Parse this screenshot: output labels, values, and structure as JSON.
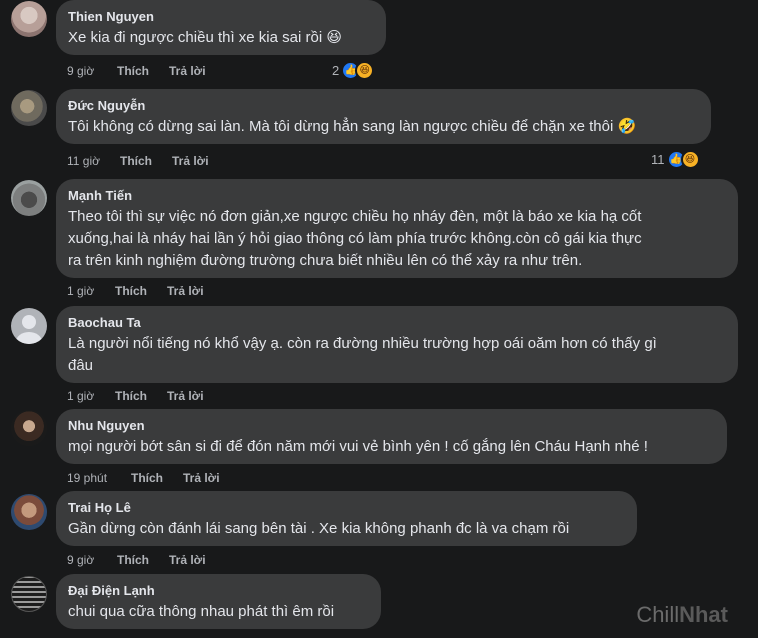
{
  "comments": [
    {
      "author": "Thien Nguyen",
      "text": "Xe kia đi ngược chiều thì xe kia sai rồi 😆",
      "time": "9 giờ",
      "like": "Thích",
      "reply": "Trả lời",
      "reaction_count": "2",
      "reactions": [
        "like",
        "haha"
      ]
    },
    {
      "author": "Đức Nguyễn",
      "text": "Tôi không có dừng sai làn. Mà tôi dừng hẳn sang làn ngược chiều để chặn xe thôi 🤣",
      "time": "11 giờ",
      "like": "Thích",
      "reply": "Trả lời",
      "reaction_count": "11",
      "reactions": [
        "like",
        "haha"
      ]
    },
    {
      "author": "Mạnh Tiến",
      "text_lines": [
        "Theo tôi thì sự việc nó đơn giản,xe ngược chiều họ nháy đèn, một là báo xe kia hạ cốt",
        "xuống,hai là nháy hai lần ý hỏi giao thông có làm phía trước không.còn cô gái kia thực",
        "ra trên kinh nghiệm đường trường chưa biết nhiều lên có thể xảy ra như trên."
      ],
      "time": "1 giờ",
      "like": "Thích",
      "reply": "Trả lời"
    },
    {
      "author": "Baochau Ta",
      "text_lines": [
        "Là người nổi tiếng nó khổ vậy ạ. còn ra đường nhiều trường hợp oái oăm hơn có thấy gì",
        "đâu"
      ],
      "time": "1 giờ",
      "like": "Thích",
      "reply": "Trả lời"
    },
    {
      "author": "Nhu Nguyen",
      "text": "mọi người bớt sân si đi để đón năm mới vui vẻ bình yên ! cố gắng lên Cháu Hạnh nhé !",
      "time": "19 phút",
      "like": "Thích",
      "reply": "Trả lời"
    },
    {
      "author": "Trai Họ Lê",
      "text": "Gần dừng còn đánh lái sang bên tài . Xe kia không phanh đc là va chạm rồi",
      "time": "9 giờ",
      "like": "Thích",
      "reply": "Trả lời"
    },
    {
      "author": "Đại Điện Lạnh",
      "text": "chui qua cữa thông nhau phát thì êm rồi"
    }
  ],
  "watermark": {
    "part1": "Chill",
    "part2": "Nhat"
  },
  "icons": {
    "like": "thumbs-up-icon",
    "haha": "haha-emoji-icon"
  },
  "colors": {
    "background": "#18191a",
    "bubble": "#3a3b3c",
    "like_blue": "#2078f4",
    "haha_yellow": "#f7b125"
  }
}
